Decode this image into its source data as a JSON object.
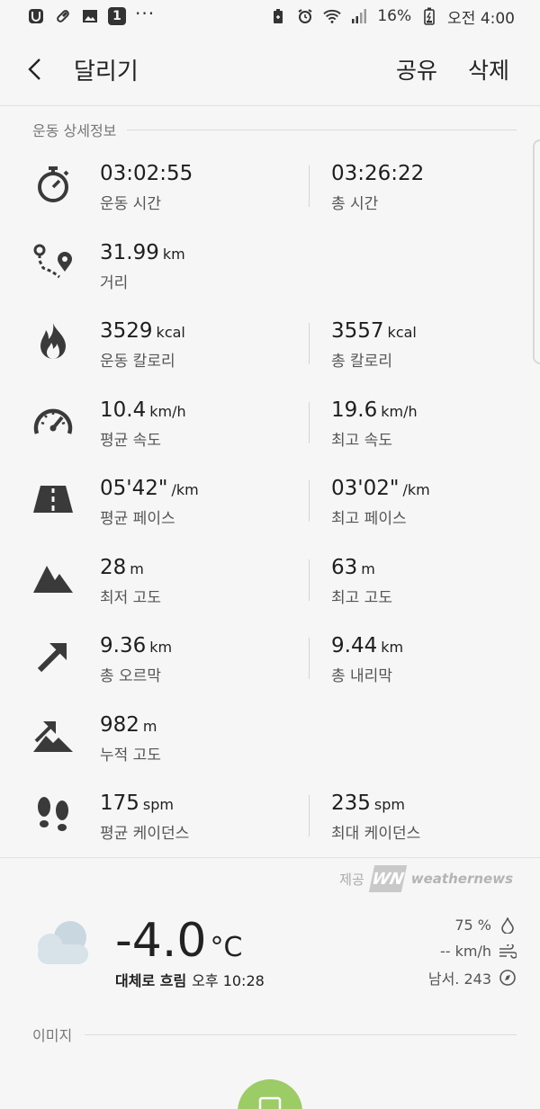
{
  "status_bar": {
    "notification_count": "1",
    "more_indicator": "···",
    "battery": "16%",
    "time": "오전 4:00",
    "icons_left": [
      "u-app-icon",
      "pill-icon",
      "image-icon",
      "number-badge-icon",
      "more-dots-icon"
    ],
    "icons_right": [
      "battery-saver-icon",
      "alarm-icon",
      "wifi-icon",
      "signal-icon",
      "battery-icon"
    ]
  },
  "header": {
    "title": "달리기",
    "share_label": "공유",
    "delete_label": "삭제"
  },
  "details": {
    "section_title": "운동 상세정보",
    "rows": [
      {
        "icon": "stopwatch-icon",
        "left": {
          "value": "03:02:55",
          "unit": "",
          "label": "운동 시간"
        },
        "right": {
          "value": "03:26:22",
          "unit": "",
          "label": "총 시간"
        }
      },
      {
        "icon": "route-icon",
        "left": {
          "value": "31.99",
          "unit": "km",
          "label": "거리"
        }
      },
      {
        "icon": "flame-icon",
        "left": {
          "value": "3529",
          "unit": "kcal",
          "label": "운동 칼로리"
        },
        "right": {
          "value": "3557",
          "unit": "kcal",
          "label": "총 칼로리"
        }
      },
      {
        "icon": "speedometer-icon",
        "left": {
          "value": "10.4",
          "unit": "km/h",
          "label": "평균 속도"
        },
        "right": {
          "value": "19.6",
          "unit": "km/h",
          "label": "최고 속도"
        }
      },
      {
        "icon": "road-icon",
        "left": {
          "value": "05'42\"",
          "unit": "/km",
          "label": "평균 페이스"
        },
        "right": {
          "value": "03'02\"",
          "unit": "/km",
          "label": "최고 페이스"
        }
      },
      {
        "icon": "mountain-icon",
        "left": {
          "value": "28",
          "unit": "m",
          "label": "최저 고도"
        },
        "right": {
          "value": "63",
          "unit": "m",
          "label": "최고 고도"
        }
      },
      {
        "icon": "arrow-up-right-icon",
        "left": {
          "value": "9.36",
          "unit": "km",
          "label": "총 오르막"
        },
        "right": {
          "value": "9.44",
          "unit": "km",
          "label": "총 내리막"
        }
      },
      {
        "icon": "elevation-gain-icon",
        "left": {
          "value": "982",
          "unit": "m",
          "label": "누적 고도"
        }
      },
      {
        "icon": "footsteps-icon",
        "left": {
          "value": "175",
          "unit": "spm",
          "label": "평균 케이던스"
        },
        "right": {
          "value": "235",
          "unit": "spm",
          "label": "최대 케이던스"
        }
      }
    ]
  },
  "weather": {
    "provider_label": "제공",
    "provider_logo": "WN",
    "provider_name": "weathernews",
    "temperature": "-4.0",
    "temp_unit": "°C",
    "condition": "대체로 흐림",
    "time": "오후 10:28",
    "humidity": "75 %",
    "wind_speed": "-- km/h",
    "wind_direction": "남서. 243",
    "icon": "cloud-icon"
  },
  "images": {
    "section_title": "이미지"
  },
  "colors": {
    "background": "#f6f6f6",
    "icon": "#3a3a3a",
    "fab": "#9ccc65",
    "cloud": "#c9d7e0"
  }
}
